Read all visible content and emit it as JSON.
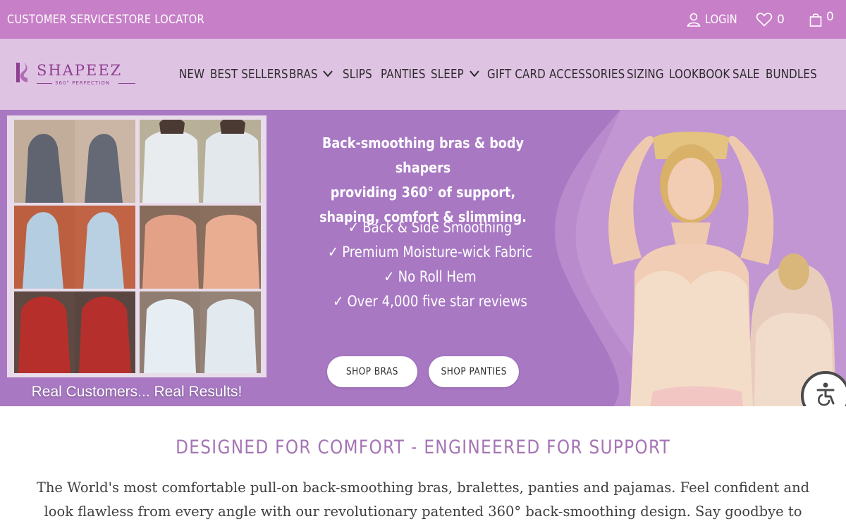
{
  "topbar": {
    "customer_service": "CUSTOMER SERVICE",
    "store_locator": "STORE LOCATOR",
    "login": "LOGIN",
    "wishlist_count": "0",
    "cart_count": "0",
    "icons": {
      "login": "user-icon",
      "wishlist": "heart-icon",
      "cart": "shopping-bag-icon"
    }
  },
  "logo": {
    "word": "SHAPEEZ",
    "tagline": "360° PERFECTION",
    "icon": "shapeez-logo-mark"
  },
  "nav": {
    "items": [
      {
        "label": "NEW"
      },
      {
        "label": "BEST SELLERS"
      },
      {
        "label": "BRAS",
        "dropdown": true
      },
      {
        "label": "SLIPS"
      },
      {
        "label": "PANTIES"
      },
      {
        "label": "SLEEP",
        "dropdown": true
      },
      {
        "label": "GIFT CARD"
      },
      {
        "label": "ACCESSORIES"
      },
      {
        "label": "SIZING"
      },
      {
        "label": "LOOKBOOK"
      },
      {
        "label": "SALE"
      },
      {
        "label": "BUNDLES"
      }
    ]
  },
  "hero": {
    "collage_caption": "Real Customers... Real Results!",
    "heading": [
      "Back-smoothing bras & body shapers",
      "providing 360° of support,",
      "shaping, comfort & slimming."
    ],
    "check_glyph": "✓",
    "features": [
      "Back & Side Smoothing",
      "Premium Moisture-wick Fabric",
      "No Roll Hem",
      "Over 4,000 five star reviews"
    ],
    "buttons": {
      "shop_bras": "SHOP BRAS",
      "shop_panties": "SHOP PANTIES"
    },
    "accessibility_icon": "accessibility-icon"
  },
  "section": {
    "title": "DESIGNED FOR COMFORT - ENGINEERED FOR SUPPORT",
    "intro": "The World's most comfortable pull-on back-smoothing bras, bralettes, panties and pajamas. Feel confident and look flawless from every angle with our revolutionary patented 360° back-smoothing design. Say goodbye to"
  },
  "colors": {
    "topbar": "#c77fc8",
    "navbar": "#dfc3e3",
    "hero": "#a878c3",
    "title_accent": "#a574b4"
  }
}
